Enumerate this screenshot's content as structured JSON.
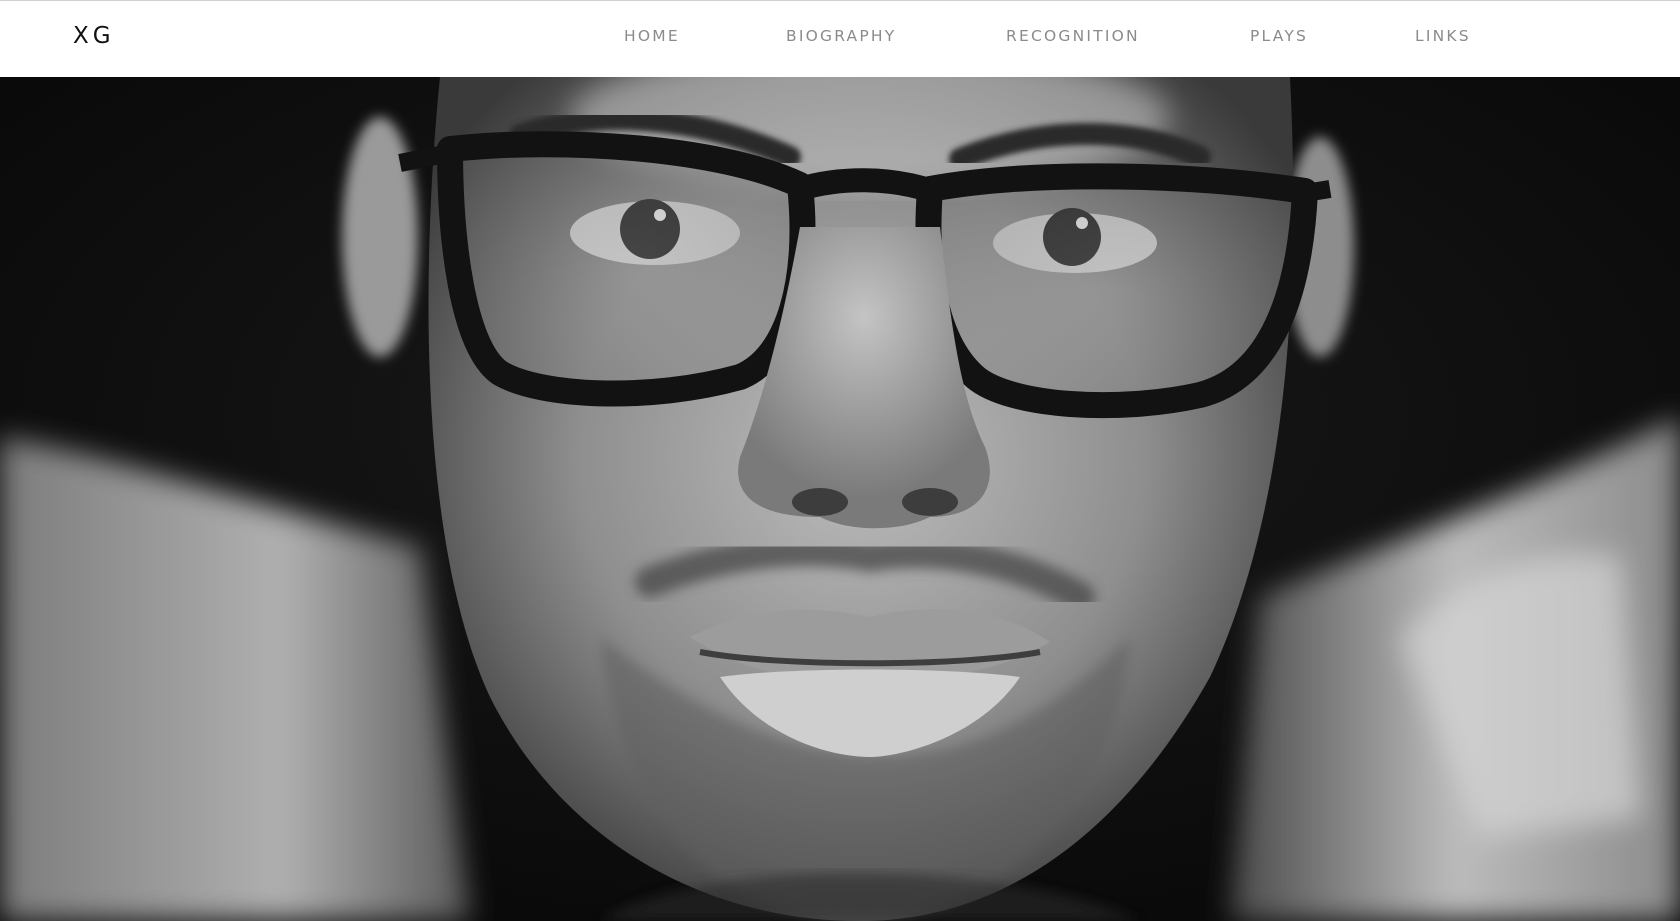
{
  "site": {
    "logo": "XG"
  },
  "nav": {
    "items": [
      {
        "label": "HOME"
      },
      {
        "label": "BIOGRAPHY"
      },
      {
        "label": "RECOGNITION"
      },
      {
        "label": "PLAYS"
      },
      {
        "label": "LINKS"
      }
    ]
  },
  "hero": {
    "image": "black-and-white close-up portrait photo of a man wearing dark-rimmed glasses"
  },
  "colors": {
    "nav_background": "#ffffff",
    "nav_text": "#8b8b8b",
    "logo_text": "#111111",
    "hero_background": "#0b0b0b"
  }
}
